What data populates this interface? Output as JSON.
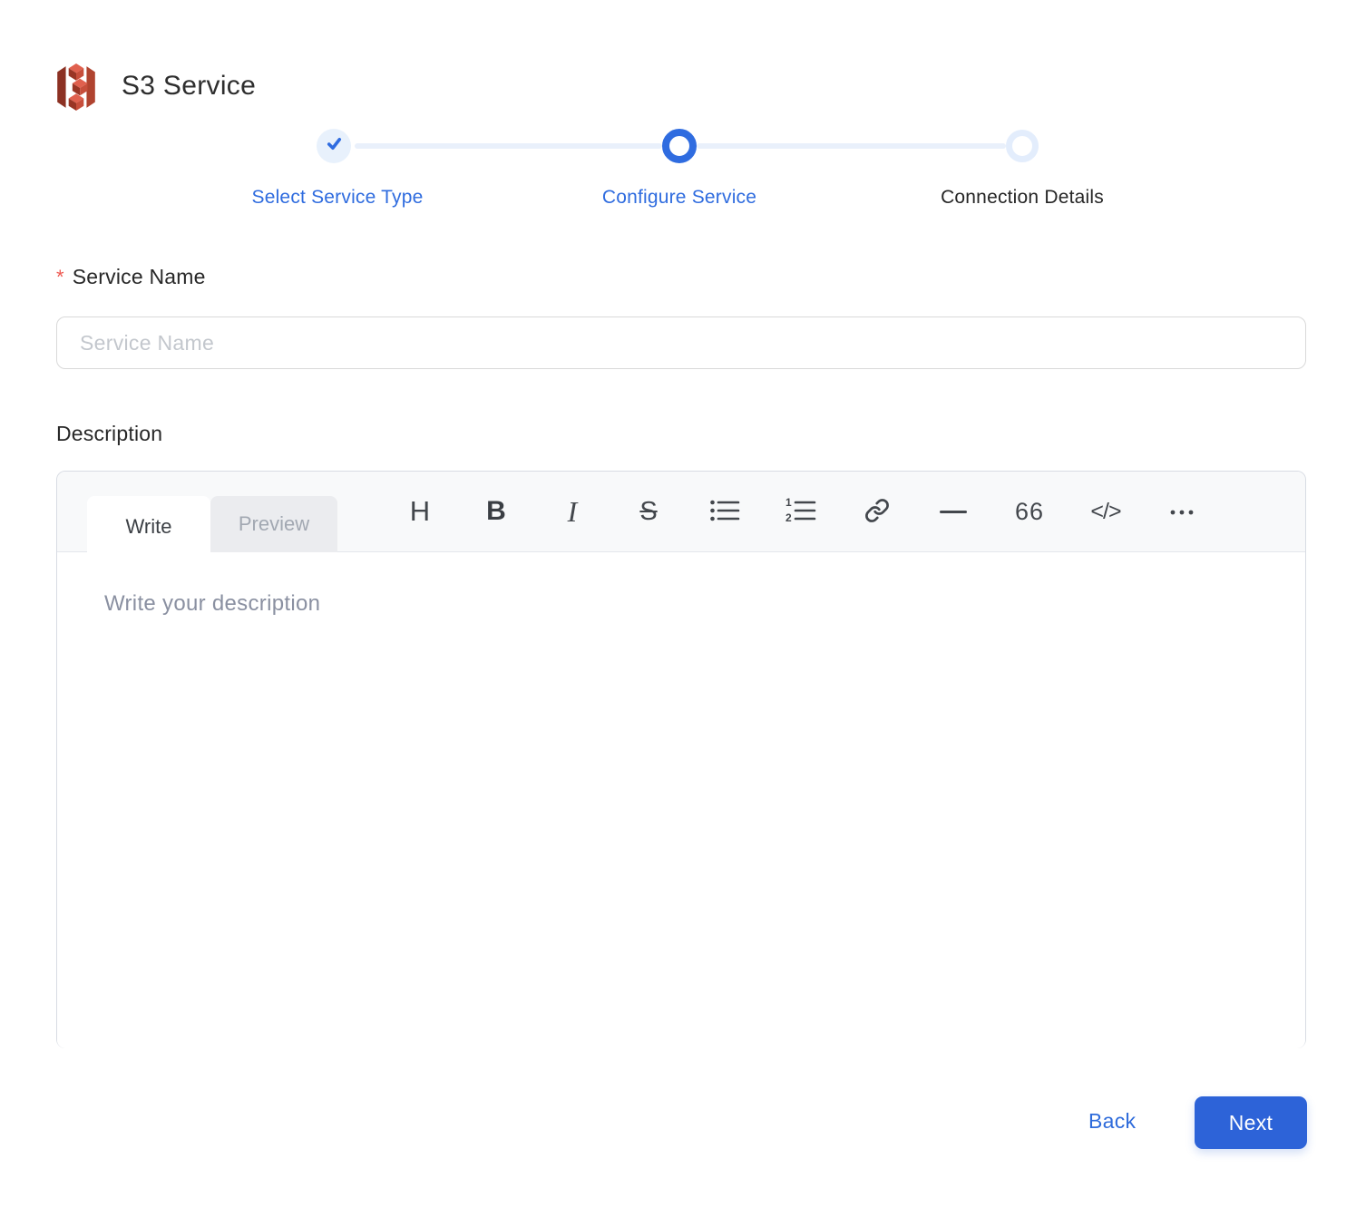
{
  "header": {
    "title": "S3 Service"
  },
  "stepper": {
    "steps": [
      {
        "label": "Select Service Type",
        "state": "completed"
      },
      {
        "label": "Configure Service",
        "state": "active"
      },
      {
        "label": "Connection Details",
        "state": "pending"
      }
    ]
  },
  "form": {
    "service_name": {
      "label": "Service Name",
      "required_marker": "*",
      "placeholder": "Service Name",
      "value": ""
    },
    "description": {
      "label": "Description",
      "editor": {
        "tabs": [
          {
            "label": "Write",
            "active": true
          },
          {
            "label": "Preview",
            "active": false
          }
        ],
        "toolbar_glyphs": {
          "heading": "H",
          "bold": "B",
          "italic": "I",
          "strikethrough": "S",
          "quote": "66",
          "code": "</>"
        },
        "placeholder": "Write your description",
        "value": ""
      }
    }
  },
  "footer": {
    "back_label": "Back",
    "next_label": "Next"
  },
  "icons": {
    "service": "s3-bucket-icon",
    "step_completed": "check-icon",
    "bulleted_list": "bulleted-list-icon",
    "numbered_list": "numbered-list-icon",
    "link": "link-icon",
    "horizontal_rule": "horizontal-rule-icon",
    "more": "ellipsis-icon"
  },
  "colors": {
    "primary": "#2f6cdf",
    "primary_button": "#2d63d8",
    "step_light": "#e8f1fc",
    "step_line": "#e9f0fb",
    "asterisk": "#ee5951",
    "s3_dark": "#8c3123",
    "s3_mid": "#b0432f",
    "s3_light": "#e05243"
  }
}
